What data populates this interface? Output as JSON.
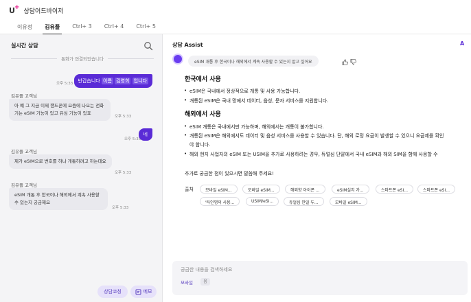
{
  "app": {
    "logo": "U",
    "logo_plus": "+",
    "title": "상담어드바이저"
  },
  "tabs": [
    {
      "label": "이유정",
      "active": false
    },
    {
      "label": "김유플",
      "active": true
    },
    {
      "label": "Ctrl+ 3",
      "active": false
    },
    {
      "label": "Ctrl+ 4",
      "active": false
    },
    {
      "label": "Ctrl+ 5",
      "active": false
    }
  ],
  "chat": {
    "title": "실시간 상담",
    "connected_notice": "통화가 연결되었습니다",
    "messages": [
      {
        "role": "agent",
        "text_a": "반갑습니다",
        "text_b": "이름",
        "text_c": "김영희",
        "text_d": "입니다",
        "time": "오후 5:33"
      },
      {
        "role": "customer",
        "name": "김유플 고객님",
        "text": "아 예 그 지금 이제 핸드폰에 요즘에 나오는 전화기는 eSIM 기능이 있고 유심 기능이 있죠",
        "time": "오후 5:33"
      },
      {
        "role": "agent",
        "text": "네",
        "time": "오후 5:33"
      },
      {
        "role": "customer",
        "name": "김유플 고객님",
        "text": "제가 eSIM으로 번호를 하나 개통하려고 하는데요",
        "time": "오후 5:33"
      },
      {
        "role": "customer",
        "name": "김유플 고객님",
        "text": "eSIM 개통 후 한국이나 해외에서 계속 사용할 수 있는지 궁금해요",
        "time": "오후 5:33"
      }
    ],
    "btn_coaching": "상담코칭",
    "btn_memo": "메모"
  },
  "assist": {
    "title": "상담 Assist",
    "corner_label": "A",
    "question": "eSIM 개통 후 한국이나 해외에서 계속 사용할 수 있는지 알고 싶어요",
    "section1_title": "한국에서 사용",
    "section1_items": [
      "eSIM은 국내에서 정상적으로 개통 및 사용 가능합니다.",
      "개통된 eSIM은 국내 망에서 데이터, 음성, 문자 서비스를 지원합니다."
    ],
    "section2_title": "해외에서 사용",
    "section2_items": [
      "eSIM 개통은 국내에서만 가능하며, 해외에서는 개통이 불가합니다.",
      "개통된 eSIM은 해외에서도 데이터 및 음성 서비스를 사용할 수 있습니다. 단, 해외 로밍 요금이 발생할 수 있으니 요금제를 확인",
      "해외 현지 사업자의 eSIM 또는 USIM을 추가로 사용하려는 경우, 듀얼심 단말에서 국내 eSIM과 해외 SIM을 함께 사용할 수"
    ],
    "section2_cont": "야 합니다.",
    "closing": "추가로 궁금한 점이 있으시면 말씀해 주세요!",
    "sources_label": "출처",
    "sources_row1": [
      "모바일 eSIM...",
      "모바일 eSIM...",
      "해외향 아이폰 ...",
      "eSIM실치 가...",
      "스마트폰 eSI...",
      "스마트폰 eSI..."
    ],
    "sources_row2": [
      "'타인명의 사용...",
      "USIM/eSI...",
      "듀얼심 안일 두...",
      "모바일 eSIM..."
    ],
    "search_placeholder": "궁금한 내용을 검색하세요",
    "search_tag": "모바일",
    "search_tag_chip": "음"
  },
  "colors": {
    "accent": "#5a2bd6",
    "brand_plus": "#e5007e"
  }
}
